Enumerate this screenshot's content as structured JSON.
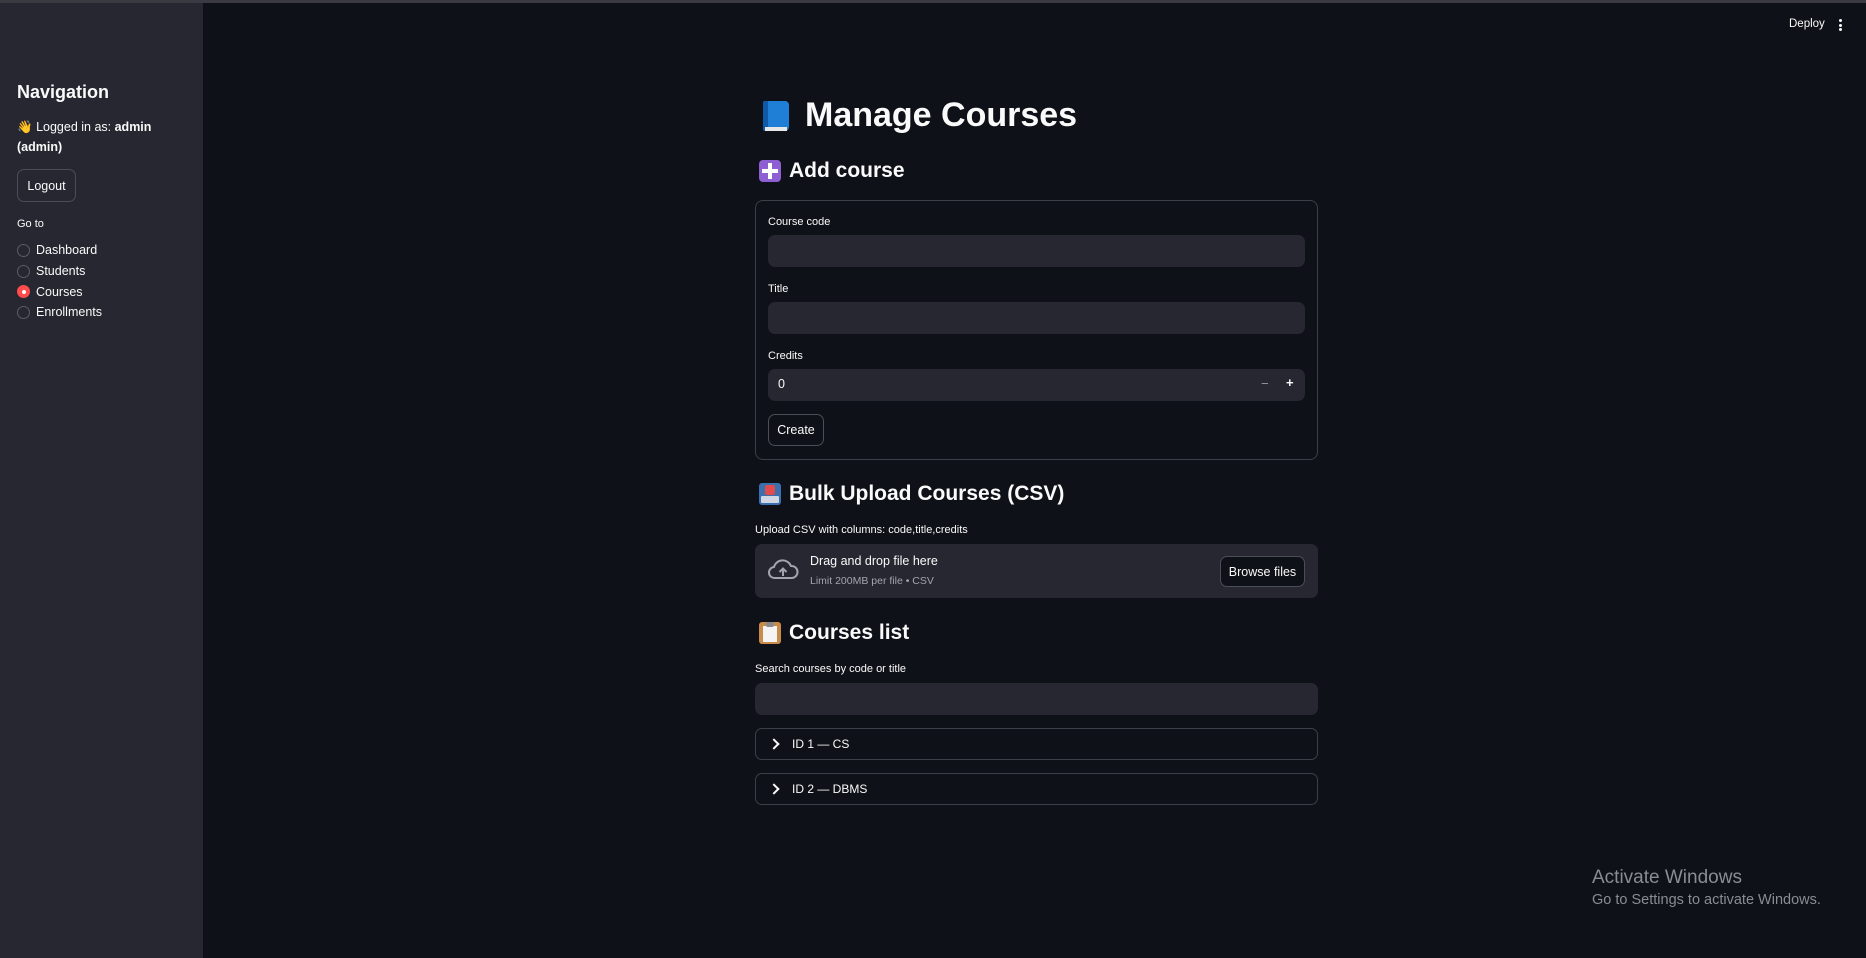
{
  "header": {
    "deploy_label": "Deploy",
    "menu_icon": "kebab-menu-icon"
  },
  "sidebar": {
    "title": "Navigation",
    "wave_emoji": "👋",
    "logged_prefix": "Logged in as:",
    "logged_user": "admin",
    "logged_role": "(admin)",
    "logout_label": "Logout",
    "goto_label": "Go to",
    "items": [
      {
        "label": "Dashboard",
        "selected": false
      },
      {
        "label": "Students",
        "selected": false
      },
      {
        "label": "Courses",
        "selected": true
      },
      {
        "label": "Enrollments",
        "selected": false
      }
    ]
  },
  "main": {
    "title": "Manage Courses",
    "add_section": {
      "heading": "Add course",
      "code_label": "Course code",
      "code_value": "",
      "title_label": "Title",
      "title_value": "",
      "credits_label": "Credits",
      "credits_value": "0",
      "minus": "−",
      "plus": "+",
      "create_label": "Create"
    },
    "bulk_section": {
      "heading": "Bulk Upload Courses (CSV)",
      "caption": "Upload CSV with columns: code,title,credits",
      "drop_title": "Drag and drop file here",
      "drop_sub": "Limit 200MB per file • CSV",
      "browse_label": "Browse files"
    },
    "list_section": {
      "heading": "Courses list",
      "search_label": "Search courses by code or title",
      "search_value": "",
      "items": [
        {
          "label": "ID 1 — CS"
        },
        {
          "label": "ID 2 — DBMS"
        }
      ]
    }
  },
  "watermark": {
    "line1": "Activate Windows",
    "line2": "Go to Settings to activate Windows."
  },
  "colors": {
    "accent": "#ff4b4b",
    "background": "#0e1117",
    "sidebar": "#262730"
  }
}
